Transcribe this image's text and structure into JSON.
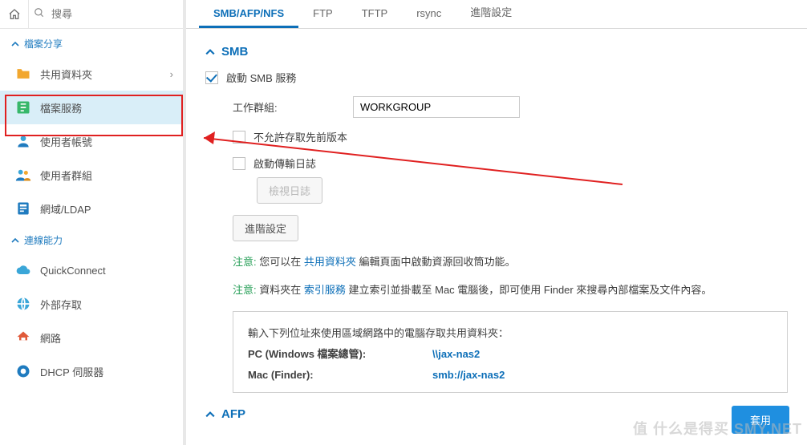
{
  "search": {
    "placeholder": "搜尋"
  },
  "groups": {
    "file_share": "檔案分享",
    "connectivity": "連線能力"
  },
  "nav": {
    "shared_folder": "共用資料夾",
    "file_services": "檔案服務",
    "user": "使用者帳號",
    "group": "使用者群組",
    "domain_ldap": "網域/LDAP",
    "quickconnect": "QuickConnect",
    "external_access": "外部存取",
    "network": "網路",
    "dhcp": "DHCP 伺服器"
  },
  "tabs": {
    "smb_afp_nfs": "SMB/AFP/NFS",
    "ftp": "FTP",
    "tftp": "TFTP",
    "rsync": "rsync",
    "advanced": "進階設定"
  },
  "smb": {
    "title": "SMB",
    "enable": "啟動 SMB 服務",
    "workgroup_label": "工作群組:",
    "workgroup_value": "WORKGROUP",
    "no_prev": "不允許存取先前版本",
    "enable_log": "啟動傳輸日誌",
    "view_log_btn": "檢視日誌",
    "advanced_btn": "進階設定",
    "note_prefix": "注意:",
    "note1_a": "您可以在 ",
    "note1_link": "共用資料夾",
    "note1_b": " 編輯頁面中啟動資源回收筒功能。",
    "note2_a": "資料夾在 ",
    "note2_link": "索引服務",
    "note2_b": " 建立索引並掛載至 Mac 電腦後，即可使用 Finder 來搜尋內部檔案及文件內容。",
    "addr_intro": "輸入下列位址來使用區域網路中的電腦存取共用資料夾：",
    "addr_pc_k": "PC (Windows 檔案總管):",
    "addr_pc_v": "\\\\jax-nas2",
    "addr_mac_k": "Mac (Finder):",
    "addr_mac_v": "smb://jax-nas2"
  },
  "afp": {
    "title": "AFP"
  },
  "footer": {
    "apply": "套用"
  },
  "watermark": "值 什么是得买 SMY.NET"
}
